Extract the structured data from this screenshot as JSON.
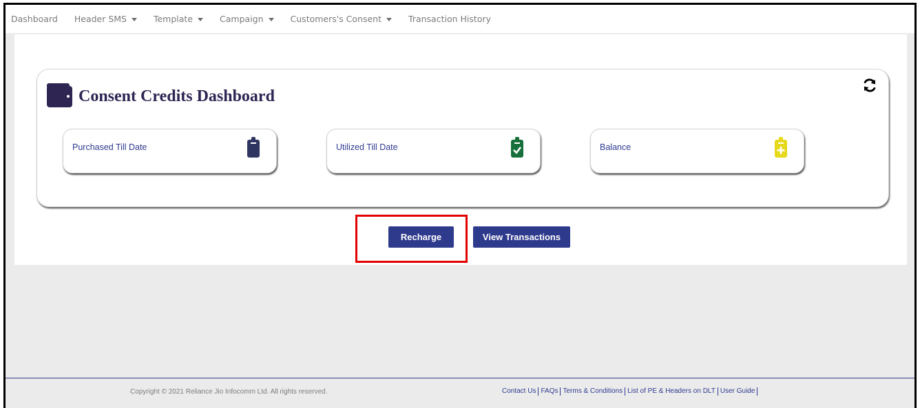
{
  "nav": {
    "items": [
      {
        "label": "Dashboard",
        "dropdown": false
      },
      {
        "label": "Header SMS",
        "dropdown": true
      },
      {
        "label": "Template",
        "dropdown": true
      },
      {
        "label": "Campaign",
        "dropdown": true
      },
      {
        "label": "Customers's Consent",
        "dropdown": true
      },
      {
        "label": "Transaction History",
        "dropdown": false
      }
    ]
  },
  "dashboard": {
    "title": "Consent Credits Dashboard",
    "title_icon": "wallet-icon",
    "refresh_icon": "refresh-icon",
    "stats": [
      {
        "label": "Purchased Till Date",
        "icon": "clipboard-icon",
        "color": "#2f3561"
      },
      {
        "label": "Utilized Till Date",
        "icon": "clipboard-check-icon",
        "color": "#17703b"
      },
      {
        "label": "Balance",
        "icon": "clipboard-plus-icon",
        "color": "#e6d81a"
      }
    ]
  },
  "actions": {
    "recharge_label": "Recharge",
    "view_transactions_label": "View Transactions"
  },
  "footer": {
    "copyright": "Copyright © 2021 Reliance Jio Infocomm Ltd. All rights reserved.",
    "links": [
      "Contact Us",
      "FAQs",
      "Terms & Conditions",
      "List of PE & Headers on DLT",
      "User Guide"
    ]
  },
  "colors": {
    "brand": "#2e3a8c",
    "highlight": "#e20000"
  }
}
